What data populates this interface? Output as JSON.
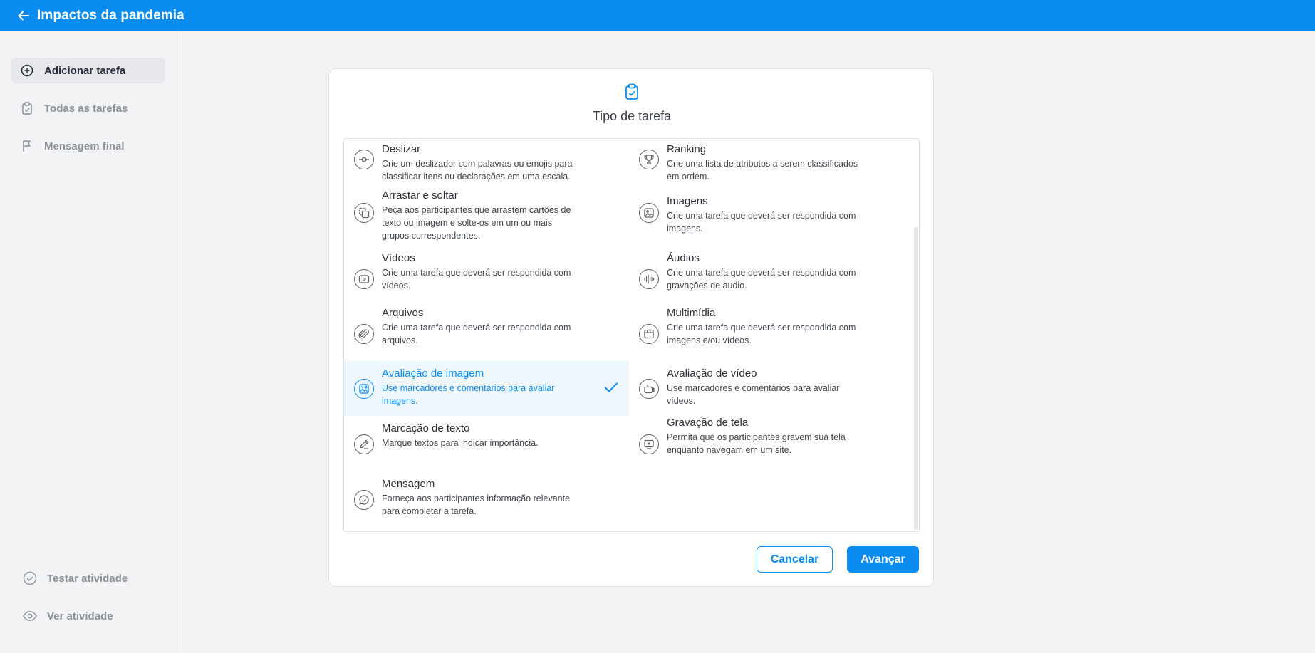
{
  "header": {
    "title": "Impactos da pandemia",
    "back_icon": "arrow-left-icon",
    "color": "#0b8cf0"
  },
  "sidebar": {
    "items": [
      {
        "label": "Adicionar tarefa",
        "icon": "plus-circle-icon"
      },
      {
        "label": "Todas as tarefas",
        "icon": "clipboard-icon"
      },
      {
        "label": "Mensagem final",
        "icon": "flag-icon"
      }
    ],
    "bottom": [
      {
        "label": "Testar atividade",
        "icon": "check-circle-icon"
      },
      {
        "label": "Ver atividade",
        "icon": "eye-icon"
      }
    ]
  },
  "modal": {
    "title": "Tipo de tarefa",
    "icon": "clipboard-check-icon",
    "tasks": [
      {
        "name": "Deslizar",
        "desc1": "Crie um deslizador com palavras ou emojis para",
        "desc2": "classificar itens ou declarações em uma escala.",
        "desc3": "",
        "icon": "slider-icon"
      },
      {
        "name": "Ranking",
        "desc1": "Crie uma lista de atributos a serem classificados",
        "desc2": "em ordem.",
        "desc3": "",
        "icon": "trophy-icon"
      },
      {
        "name": "Arrastar e soltar",
        "desc1": "Peça aos participantes que arrastem cartões de",
        "desc2": "texto ou imagem e solte-os em um ou mais",
        "desc3": "grupos correspondentes.",
        "icon": "drag-drop-icon"
      },
      {
        "name": "Imagens",
        "desc1": "Crie uma tarefa que deverá ser respondida com",
        "desc2": "imagens.",
        "desc3": "",
        "icon": "image-icon"
      },
      {
        "name": "Vídeos",
        "desc1": "Crie uma tarefa que deverá ser respondida com",
        "desc2": "vídeos.",
        "desc3": "",
        "icon": "video-play-icon"
      },
      {
        "name": "Áudios",
        "desc1": "Crie uma tarefa que deverá ser respondida com",
        "desc2": "gravações de audio.",
        "desc3": "",
        "icon": "audio-wave-icon"
      },
      {
        "name": "Arquivos",
        "desc1": "Crie uma tarefa que deverá ser respondida com",
        "desc2": "arquivos.",
        "desc3": "",
        "icon": "paperclip-icon"
      },
      {
        "name": "Multimídia",
        "desc1": "Crie uma tarefa que deverá ser respondida com",
        "desc2": "imagens e/ou vídeos.",
        "desc3": "",
        "icon": "multimedia-icon"
      },
      {
        "name": "Avaliação de imagem",
        "desc1": "Use marcadores e comentários para avaliar",
        "desc2": "imagens.",
        "desc3": "",
        "icon": "image-review-icon",
        "selected": true
      },
      {
        "name": "Avaliação de vídeo",
        "desc1": "Use marcadores e comentários para avaliar",
        "desc2": "vídeos.",
        "desc3": "",
        "icon": "video-review-icon"
      },
      {
        "name": "Marcação de texto",
        "desc1": "Marque textos para indicar importância.",
        "desc2": "",
        "desc3": "",
        "icon": "pen-icon"
      },
      {
        "name": "Gravação de tela",
        "desc1": "Permita que os participantes gravem sua tela",
        "desc2": "enquanto navegam em um site.",
        "desc3": "",
        "icon": "screen-record-icon"
      },
      {
        "name": "Mensagem",
        "desc1": "Forneça aos participantes informação relevante",
        "desc2": "para completar a tarefa.",
        "desc3": "",
        "icon": "message-icon"
      }
    ],
    "cancel_label": "Cancelar",
    "next_label": "Avançar"
  }
}
